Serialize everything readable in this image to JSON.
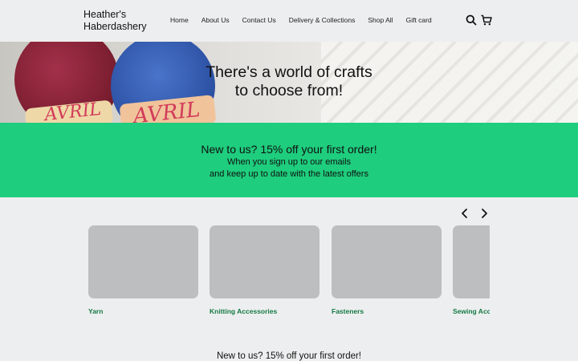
{
  "header": {
    "brand": "Heather's Haberdashery",
    "nav": [
      "Home",
      "About Us",
      "Contact Us",
      "Delivery & Collections",
      "Shop All",
      "Gift card"
    ],
    "icons": {
      "search": "search-icon",
      "cart": "cart-icon"
    }
  },
  "hero": {
    "title_line1": "There's a world of crafts",
    "title_line2": "to choose from!",
    "yarn_brand": "AVRIL"
  },
  "promo": {
    "title": "New to us? 15% off your first order!",
    "line1": "When you sign up to our emails",
    "line2": "and keep up to date with the latest offers",
    "color": "#1ecd7d"
  },
  "carousel": {
    "prev_icon": "chevron-left-icon",
    "next_icon": "chevron-right-icon",
    "categories": [
      "Yarn",
      "Knitting Accessories",
      "Fasteners",
      "Sewing Accessories"
    ]
  },
  "footer_promo": {
    "title": "New to us? 15% off your first order!"
  },
  "colors": {
    "category_label": "#137a45",
    "placeholder": "#bdbebf",
    "background": "#edeeef"
  }
}
